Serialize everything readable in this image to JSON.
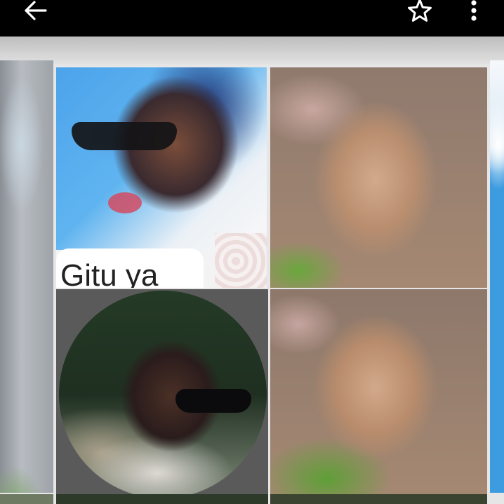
{
  "toolbar": {
    "back_icon": "arrow-left-icon",
    "star_icon": "star-outline-icon",
    "more_icon": "more-vert-icon"
  },
  "grid": {
    "tiles": [
      {
        "caption": "Gitu ya"
      },
      {
        "caption": ""
      },
      {
        "caption": ""
      },
      {
        "caption": ""
      }
    ]
  }
}
